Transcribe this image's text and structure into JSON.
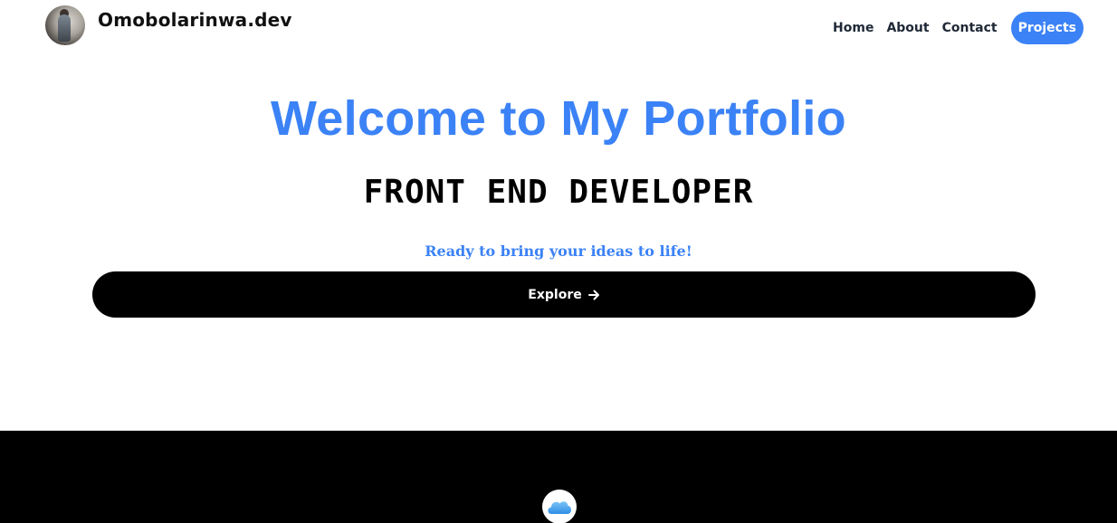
{
  "header": {
    "brand": "Omobolarinwa.dev",
    "nav": {
      "home": "Home",
      "about": "About",
      "contact": "Contact",
      "projects": "Projects"
    }
  },
  "hero": {
    "title": "Welcome to My Portfolio",
    "role": "FRONT END DEVELOPER",
    "tagline": "Ready to bring your ideas to life!",
    "cta_label": "Explore"
  },
  "footer": {
    "icon": "cloud-icon"
  },
  "colors": {
    "accent": "#3b82f6",
    "footer_bg": "#000000",
    "cta_bg": "#000000"
  }
}
